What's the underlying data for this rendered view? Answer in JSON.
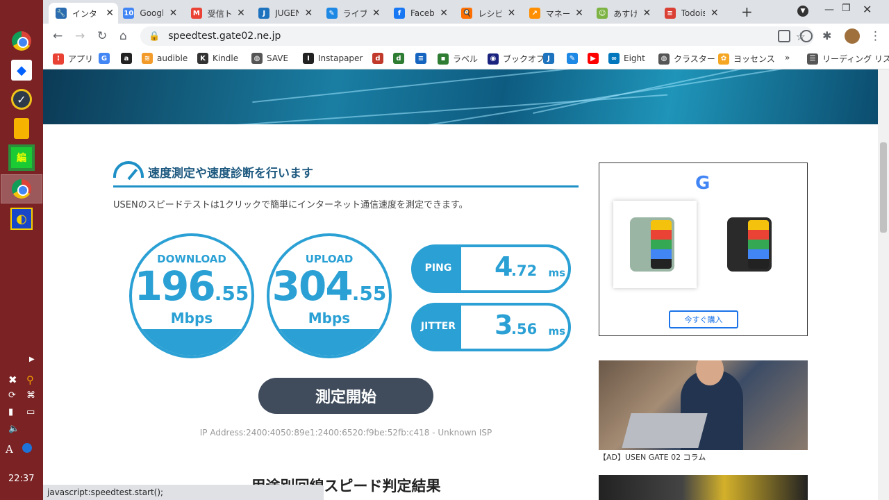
{
  "taskbar": {
    "clock": "22:37",
    "ime": "A",
    "apps": [
      "windows-start",
      "chrome",
      "dropbox",
      "todo-check",
      "google-keep",
      "notes-app",
      "chrome-active",
      "game-app"
    ]
  },
  "tabs": [
    {
      "title": "インター",
      "color": "#2b6cb0",
      "glyph": "🔧",
      "active": true
    },
    {
      "title": "Googl",
      "color": "#4285f4",
      "glyph": "10"
    },
    {
      "title": "受信ト",
      "color": "#ea4335",
      "glyph": "M"
    },
    {
      "title": "JUGEN",
      "color": "#1e73be",
      "glyph": "J"
    },
    {
      "title": "ライブド",
      "color": "#1e88e5",
      "glyph": "✎"
    },
    {
      "title": "Faceb",
      "color": "#1877f2",
      "glyph": "f"
    },
    {
      "title": "レシピを",
      "color": "#ff6f00",
      "glyph": "🍳"
    },
    {
      "title": "マネーフ",
      "color": "#ff8f00",
      "glyph": "↗"
    },
    {
      "title": "あすけん",
      "color": "#7cb342",
      "glyph": "☺"
    },
    {
      "title": "Todois",
      "color": "#db4035",
      "glyph": "≡"
    }
  ],
  "toolbar": {
    "url": "speedtest.gate02.ne.jp",
    "back": "←",
    "forward": "→",
    "reload": "↻",
    "home": "⌂",
    "lock": "🔒",
    "star": "☆",
    "new_tab": "+",
    "menu": "⋮",
    "extensions_icon": "✱"
  },
  "bookmarks": [
    {
      "label": "アプリ",
      "color": "#e94235",
      "glyph": "⁝"
    },
    {
      "label": "",
      "color": "#4285f4",
      "glyph": "G"
    },
    {
      "label": "",
      "color": "#222222",
      "glyph": "a"
    },
    {
      "label": "audible",
      "color": "#f29b2b",
      "glyph": "≋"
    },
    {
      "label": "Kindle",
      "color": "#333333",
      "glyph": "K"
    },
    {
      "label": "SAVE",
      "color": "#555555",
      "glyph": "◍"
    },
    {
      "label": "Instapaper",
      "color": "#222222",
      "glyph": "I"
    },
    {
      "label": "",
      "color": "#c0392b",
      "glyph": "d"
    },
    {
      "label": "",
      "color": "#2e7d32",
      "glyph": "d"
    },
    {
      "label": "",
      "color": "#1565c0",
      "glyph": "≡"
    },
    {
      "label": "ラベル",
      "color": "#2e7d32",
      "glyph": "▪"
    },
    {
      "label": "ブックオフ",
      "color": "#1a237e",
      "glyph": "◉"
    },
    {
      "label": "",
      "color": "#1e73be",
      "glyph": "J"
    },
    {
      "label": "",
      "color": "#1e88e5",
      "glyph": "✎"
    },
    {
      "label": "",
      "color": "#ff0000",
      "glyph": "▶"
    },
    {
      "label": "Eight",
      "color": "#0277bd",
      "glyph": "∞"
    },
    {
      "label": "クラスター",
      "color": "#555555",
      "glyph": "◍"
    },
    {
      "label": "ヨッセンス",
      "color": "#f5a623",
      "glyph": "✿"
    },
    {
      "label": "»",
      "color": "",
      "glyph": ""
    },
    {
      "label": "リーディング リスト",
      "color": "#555555",
      "glyph": "☰"
    }
  ],
  "page": {
    "section_title": "速度測定や速度診断を行います",
    "intro": "USENのスピードテストは1クリックで簡単にインターネット通信速度を測定できます。",
    "download": {
      "label": "DOWNLOAD",
      "int": "196",
      "dec": ".55",
      "unit": "Mbps"
    },
    "upload": {
      "label": "UPLOAD",
      "int": "304",
      "dec": ".55",
      "unit": "Mbps"
    },
    "ping": {
      "label": "PING",
      "int": "4",
      "dec": ".72",
      "unit": "ms"
    },
    "jitter": {
      "label": "JITTER",
      "int": "3",
      "dec": ".56",
      "unit": "ms"
    },
    "start_button": "測定開始",
    "ip_text": "IP Address:2400:4050:89e1:2400:6520:f9be:52fb:c418 - Unknown ISP",
    "sub_heading": "用途別回線スピード判定結果"
  },
  "ads": {
    "google_logo": "G",
    "buy_button": "今すぐ購入",
    "caption": "【AD】USEN GATE 02 コラム"
  },
  "status_bar": "javascript:speedtest.start();"
}
